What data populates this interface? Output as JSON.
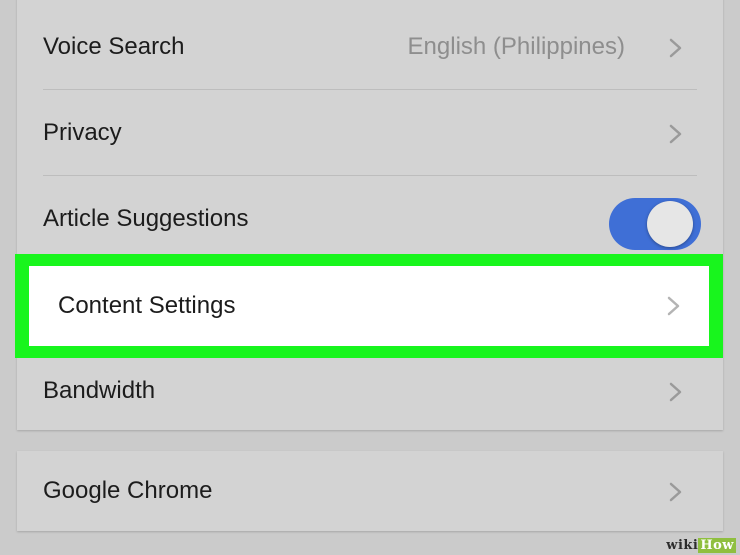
{
  "settings": {
    "voice_search": {
      "label": "Voice Search",
      "value": "English (Philippines)"
    },
    "privacy": {
      "label": "Privacy"
    },
    "article_suggestions": {
      "label": "Article Suggestions",
      "enabled": true
    },
    "content_settings": {
      "label": "Content Settings"
    },
    "bandwidth": {
      "label": "Bandwidth"
    },
    "google_chrome": {
      "label": "Google Chrome"
    }
  },
  "colors": {
    "highlight": "#18f51d",
    "toggle_on": "#3f6fd6"
  },
  "watermark": {
    "part1": "wiki",
    "part2": "How"
  }
}
